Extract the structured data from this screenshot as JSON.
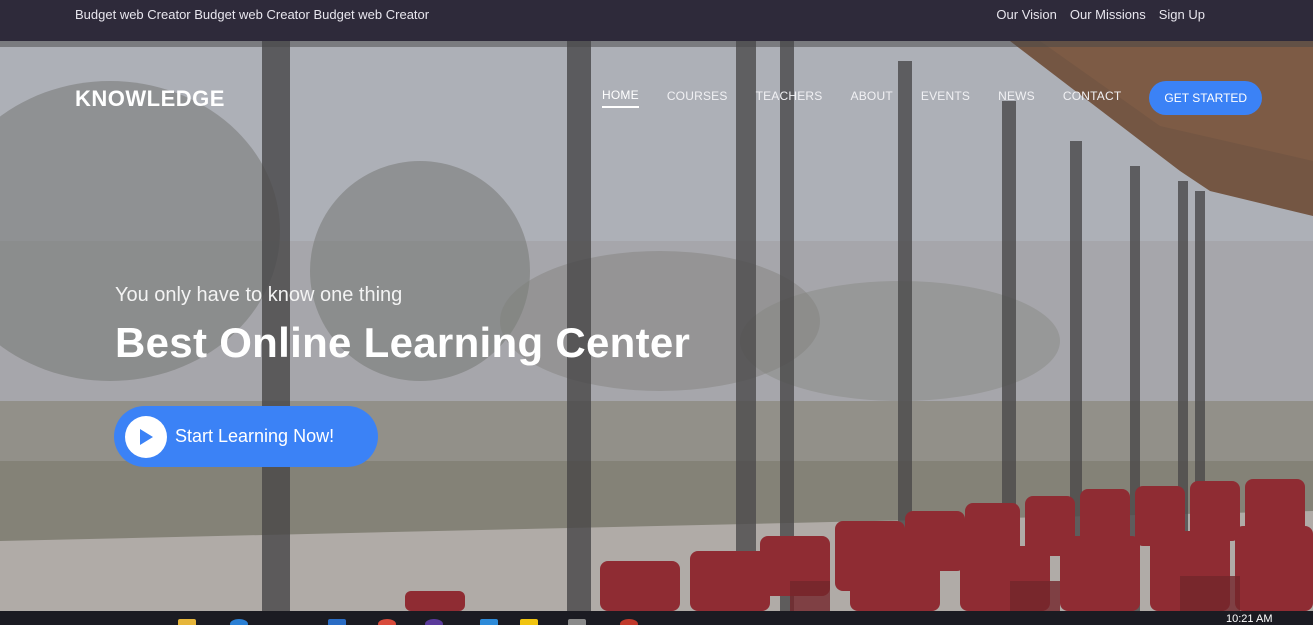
{
  "topbar": {
    "tagline": "Budget web Creator Budget web Creator Budget web Creator",
    "links": [
      "Our Vision",
      "Our Missions",
      "Sign Up"
    ]
  },
  "header": {
    "logo": "KNOWLEDGE",
    "nav": [
      "HOME",
      "COURSES",
      "TEACHERS",
      "ABOUT",
      "EVENTS",
      "NEWS",
      "CONTACT"
    ],
    "active_nav": "HOME",
    "cta": "GET STARTED"
  },
  "hero": {
    "subtitle": "You only have to know one thing",
    "headline": "Best Online Learning Center",
    "button": "Start Learning Now!"
  },
  "taskbar": {
    "clock": "10:21 AM"
  },
  "colors": {
    "accent": "#3b82f6",
    "topbar_bg": "#2e2a3a",
    "chair_red": "#8e1b22"
  }
}
